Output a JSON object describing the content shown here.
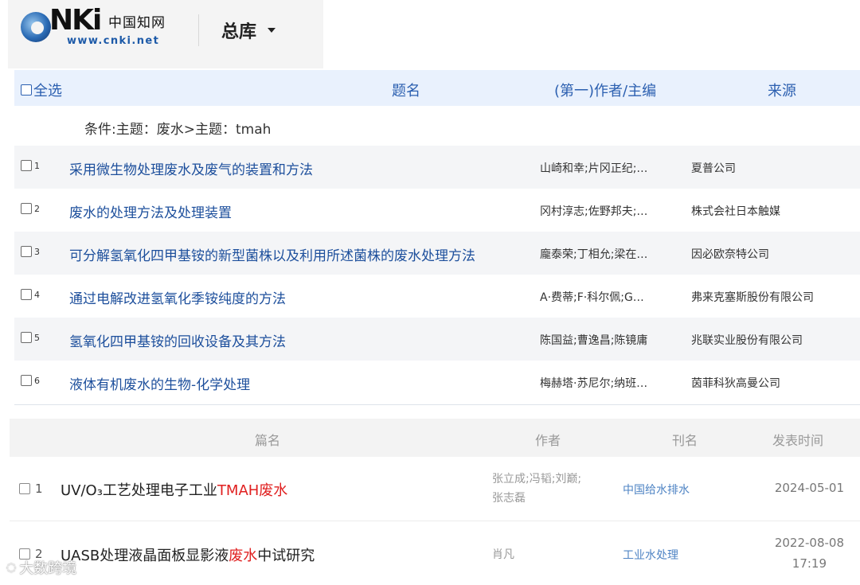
{
  "header": {
    "logo_text": "CNKI",
    "logo_cn": "中国知网",
    "logo_url": "www.cnki.net",
    "database_selector": "总库"
  },
  "results_table": {
    "select_all": "全选",
    "columns": {
      "title": "题名",
      "author": "(第一)作者/主编",
      "source": "来源"
    },
    "condition": "条件:主题：废水>主题：tmah",
    "rows": [
      {
        "num": "1",
        "title": "采用微生物处理废水及废气的装置和方法",
        "author": "山崎和幸;片冈正纪;…",
        "source": "夏普公司"
      },
      {
        "num": "2",
        "title": "废水的处理方法及处理装置",
        "author": "冈村淳志;佐野邦夫;…",
        "source": "株式会社日本触媒"
      },
      {
        "num": "3",
        "title": "可分解氢氧化四甲基铵的新型菌株以及利用所述菌株的废水处理方法",
        "author": "龐泰荣;丁相允;梁在…",
        "source": "因必欧奈特公司"
      },
      {
        "num": "4",
        "title": "通过电解改进氢氧化季铵纯度的方法",
        "author": "A·费蒂;F·科尔佩;G…",
        "source": "弗来克塞斯股份有限公司"
      },
      {
        "num": "5",
        "title": "氢氧化四甲基铵的回收设备及其方法",
        "author": "陈国益;曹逸昌;陈镜庸",
        "source": "兆联实业股份有限公司"
      },
      {
        "num": "6",
        "title": "液体有机废水的生物-化学处理",
        "author": "梅赫塔·苏尼尔;纳班…",
        "source": "茵菲科狄高曼公司"
      }
    ]
  },
  "journal_table": {
    "columns": {
      "title": "篇名",
      "author": "作者",
      "journal": "刊名",
      "date": "发表时间"
    },
    "rows": [
      {
        "num": "1",
        "title_pre": "UV/O₃工艺处理电子工业",
        "title_hl": "TMAH废水",
        "title_post": "",
        "author_line1": "张立成;冯韬;刘巅;",
        "author_line2": "张志磊",
        "journal": "中国给水排水",
        "date_line1": "2024-05-01",
        "date_line2": ""
      },
      {
        "num": "2",
        "title_pre": "UASB处理液晶面板显影液",
        "title_hl": "废水",
        "title_post": "中试研究",
        "author_line1": "肖凡",
        "author_line2": "",
        "journal": "工业水处理",
        "date_line1": "2022-08-08",
        "date_line2": "17:19"
      }
    ]
  },
  "watermark": "大数跨境",
  "colors": {
    "link_blue": "#1d4f9c",
    "header_blue": "#2b5fb0",
    "highlight_red": "#e02020",
    "journal_blue": "#4f84c4",
    "table_header_bg": "#e9f1fd"
  }
}
